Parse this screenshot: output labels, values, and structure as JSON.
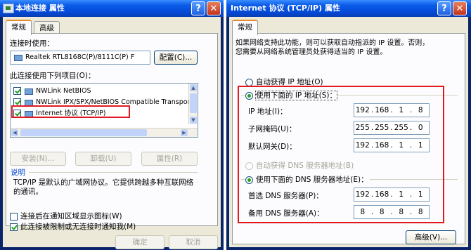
{
  "left_dialog": {
    "title": "本地连接 属性",
    "tabs": [
      "常规",
      "高级"
    ],
    "connect_using_label": "连接时使用：",
    "adapter_name": "Realtek RTL8168C(P)/8111C(P) F",
    "configure_button": "配置(C)...",
    "items_label": "此连接使用下列项目(O)：",
    "components": [
      {
        "label": "NWLink NetBIOS",
        "checked": true
      },
      {
        "label": "NWLink IPX/SPX/NetBIOS Compatible Transpor",
        "checked": true
      },
      {
        "label": "Internet 协议 (TCP/IP)",
        "checked": true
      }
    ],
    "install_button": "安装(N)...",
    "uninstall_button": "卸载(U)",
    "properties_button": "属性(R)",
    "description_label": "说明",
    "description_text": "TCP/IP 是默认的广域网协议。它提供跨越多种互联网络的通讯。",
    "show_icon_label": "连接后在通知区域显示图标(W)",
    "show_icon_checked": false,
    "notify_label": "此连接被限制或无连接时通知我(M)",
    "notify_checked": true,
    "ok_button": "确定",
    "cancel_button": "取消"
  },
  "right_dialog": {
    "title": "Internet 协议 (TCP/IP) 属性",
    "tab": "常规",
    "intro_line1": "如果网络支持此功能，则可以获取自动指派的 IP 设置。否则，",
    "intro_line2": "您需要从网络系统管理员处获得适当的 IP 设置。",
    "auto_ip_label": "自动获得 IP 地址(O)",
    "manual_ip_label": "使用下面的 IP 地址(S)：",
    "ip_address_label": "IP 地址(I)：",
    "ip_address": [
      "192",
      "168",
      "1",
      "8"
    ],
    "subnet_label": "子网掩码(U)：",
    "subnet": [
      "255",
      "255",
      "255",
      "0"
    ],
    "gateway_label": "默认网关(D)：",
    "gateway": [
      "192",
      "168",
      "1",
      "1"
    ],
    "auto_dns_label": "自动获得 DNS 服务器地址(B)",
    "manual_dns_label": "使用下面的 DNS 服务器地址(E)：",
    "preferred_dns_label": "首选 DNS 服务器(P)：",
    "preferred_dns": [
      "192",
      "168",
      "1",
      "1"
    ],
    "alternate_dns_label": "备用 DNS 服务器(A)：",
    "alternate_dns": [
      "8",
      "8",
      "8",
      "8"
    ],
    "advanced_button": "高级(V)..."
  },
  "colors": {
    "highlight": "#e0191f",
    "title_bar": "#0548d6",
    "dialog_bg": "#ece9d8"
  }
}
